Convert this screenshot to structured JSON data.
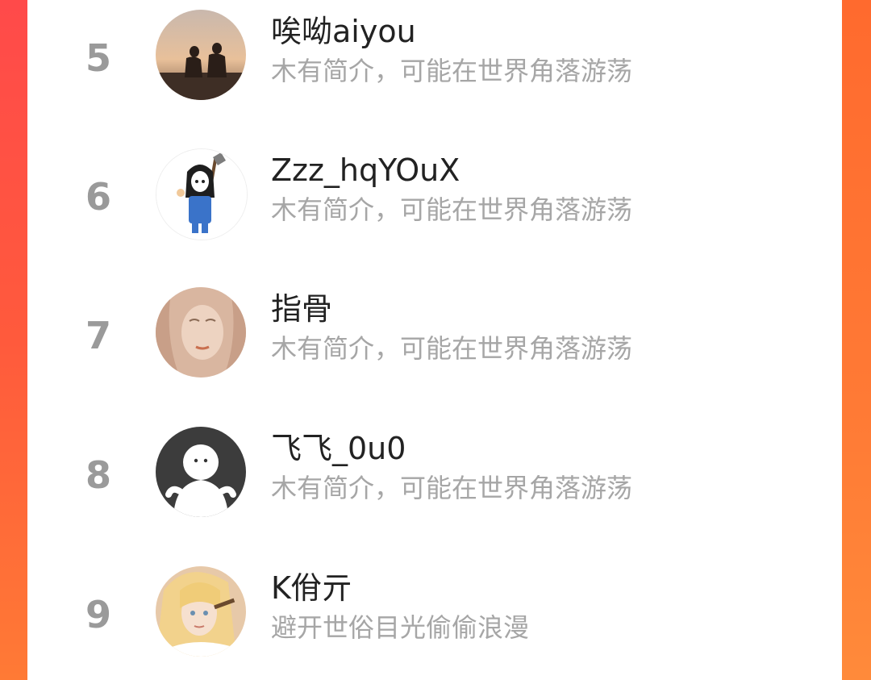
{
  "theme": {
    "accent": "#ff5a3c",
    "rank_color": "#9a9a9a",
    "name_color": "#222222",
    "bio_color": "#a6a6a6"
  },
  "rankings": [
    {
      "rank": "5",
      "name": "唉呦aiyou",
      "bio": "木有简介，可能在世界角落游荡",
      "avatar_icon": "sunset-couple-avatar"
    },
    {
      "rank": "6",
      "name": "Zzz_hqYOuX",
      "bio": "木有简介，可能在世界角落游荡",
      "avatar_icon": "cartoon-girl-shovel-avatar"
    },
    {
      "rank": "7",
      "name": "指骨",
      "bio": "木有简介，可能在世界角落游荡",
      "avatar_icon": "sketch-face-avatar"
    },
    {
      "rank": "8",
      "name": "飞飞_0u0",
      "bio": "木有简介，可能在世界角落游荡",
      "avatar_icon": "default-ghost-avatar"
    },
    {
      "rank": "9",
      "name": "K佾亓",
      "bio": "避开世俗目光偷偷浪漫",
      "avatar_icon": "anime-blonde-avatar"
    }
  ]
}
